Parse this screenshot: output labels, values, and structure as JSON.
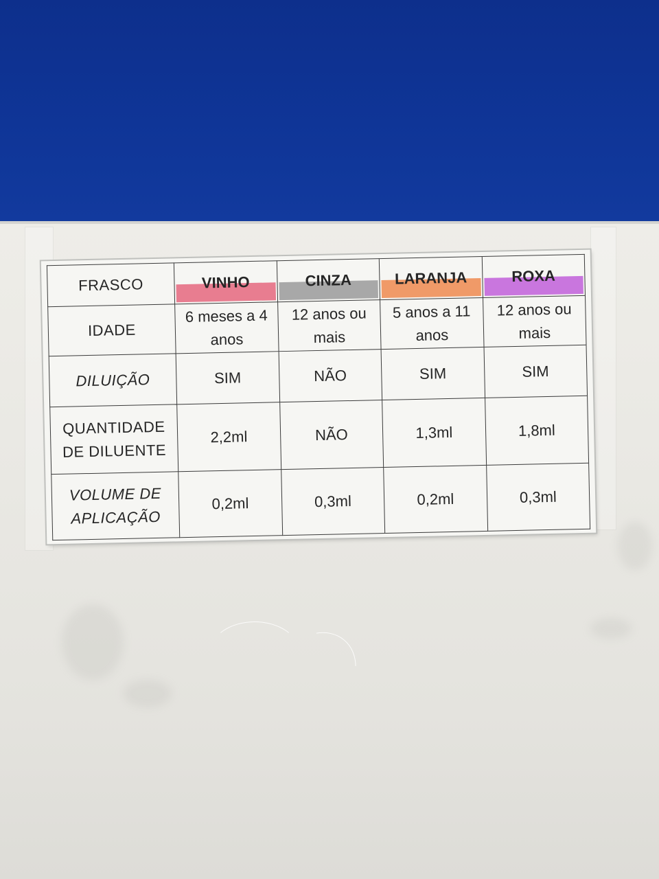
{
  "table": {
    "header_label": "FRASCO",
    "vials": [
      {
        "name": "VINHO",
        "color": "#e5677e"
      },
      {
        "name": "CINZA",
        "color": "#9a9a9a"
      },
      {
        "name": "LARANJA",
        "color": "#ef8a4f"
      },
      {
        "name": "ROXA",
        "color": "#c15fd9"
      }
    ],
    "rows": [
      {
        "label": "IDADE",
        "values": [
          "6 meses a 4 anos",
          "12 anos ou mais",
          "5 anos a 11 anos",
          "12 anos ou mais"
        ]
      },
      {
        "label": "DILUIÇÃO",
        "values": [
          "SIM",
          "NÃO",
          "SIM",
          "SIM"
        ]
      },
      {
        "label": "QUANTIDADE DE DILUENTE",
        "values": [
          "2,2ml",
          "NÃO",
          "1,3ml",
          "1,8ml"
        ]
      },
      {
        "label": "VOLUME DE APLICAÇÃO",
        "values": [
          "0,2ml",
          "0,3ml",
          "0,2ml",
          "0,3ml"
        ]
      }
    ]
  },
  "colors": {
    "upper_panel": "#0f3597",
    "wall": "#e9e8e3",
    "paper": "#f6f6f3"
  }
}
